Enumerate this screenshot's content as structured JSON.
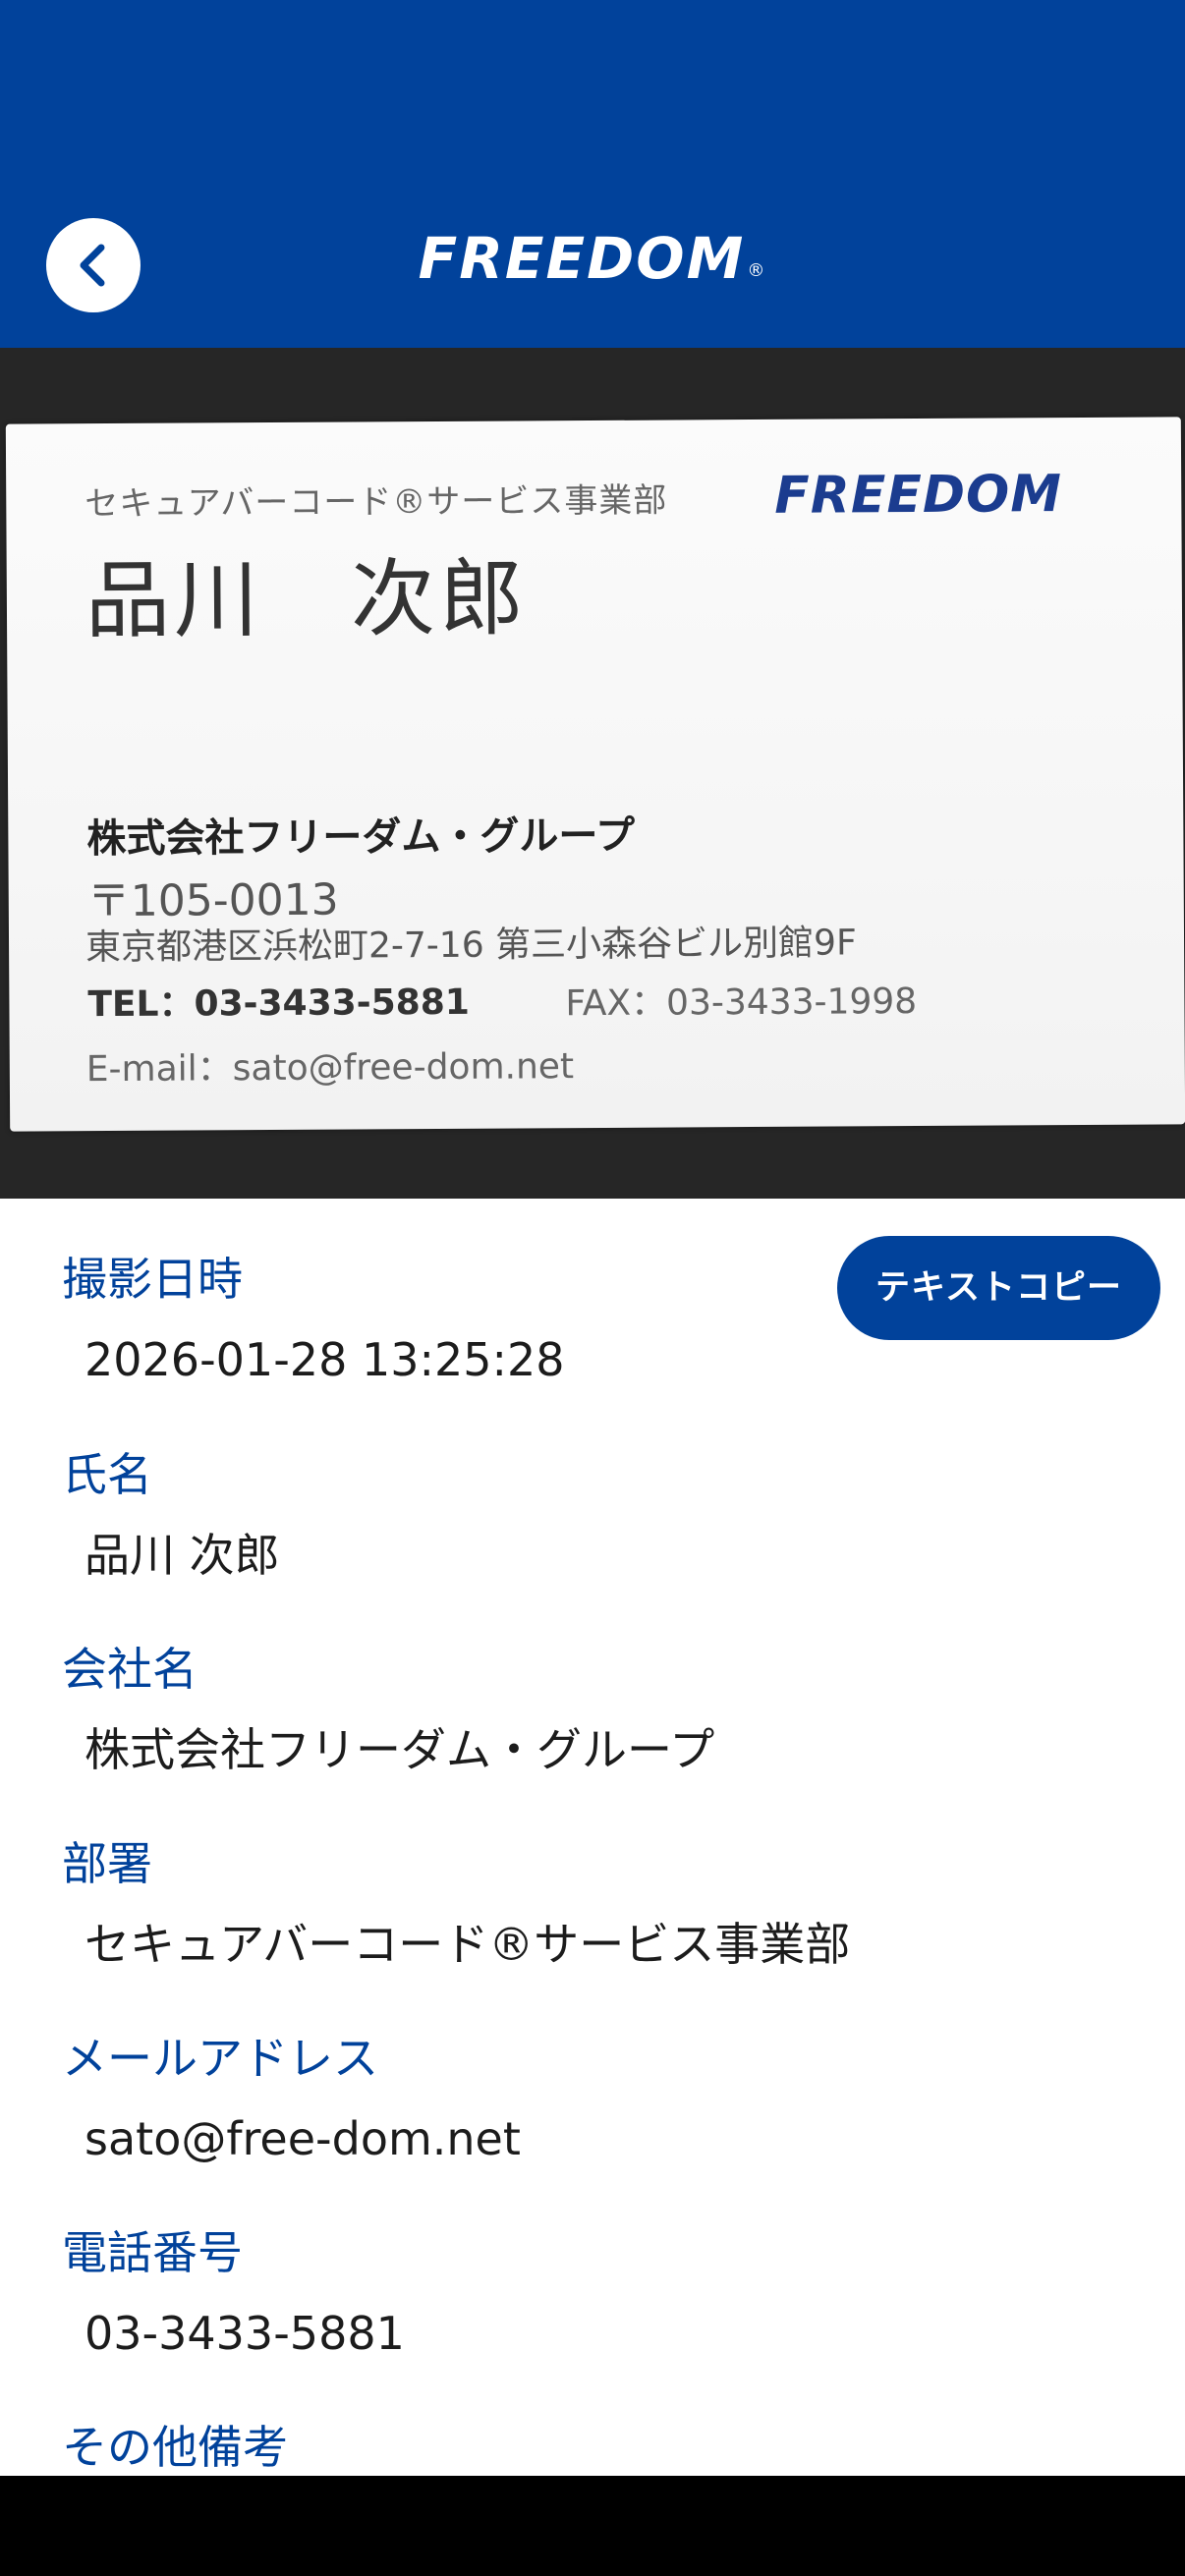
{
  "header": {
    "brand": "FREEDOM",
    "brand_mark": "®",
    "back_icon": "chevron-left-icon",
    "colors": {
      "header_bg": "#01429b",
      "accent": "#01429b"
    }
  },
  "card_photo": {
    "department": "セキュアバーコード®サービス事業部",
    "name": "品川　次郎",
    "logo_text": "FREEDOM",
    "company": "株式会社フリーダム・グループ",
    "zip": "〒105-0013",
    "address": "東京都港区浜松町2-7-16 第三小森谷ビル別館9F",
    "tel": "TEL：03-3433-5881",
    "fax": "FAX：03-3433-1998",
    "email": "E-mail：sato@free-dom.net"
  },
  "actions": {
    "copy_label": "テキストコピー"
  },
  "fields": {
    "captured": {
      "label": "撮影日時",
      "value": "2026-01-28 13:25:28"
    },
    "name": {
      "label": "氏名",
      "value": "品川 次郎"
    },
    "company": {
      "label": "会社名",
      "value": "株式会社フリーダム・グループ"
    },
    "department": {
      "label": "部署",
      "value": "セキュアバーコード®サービス事業部"
    },
    "email": {
      "label": "メールアドレス",
      "value": "sato@free-dom.net"
    },
    "phone": {
      "label": "電話番号",
      "value": "03-3433-5881"
    },
    "notes": {
      "label": "その他備考"
    }
  }
}
